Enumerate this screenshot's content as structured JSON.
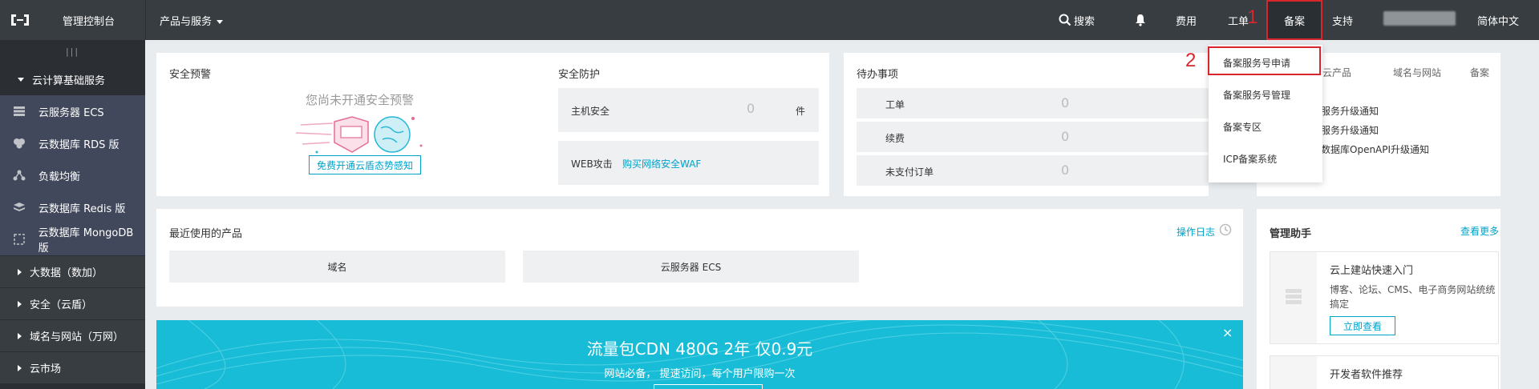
{
  "topbar": {
    "console_title": "管理控制台",
    "products_label": "产品与服务",
    "search_label": "搜索",
    "fee_label": "费用",
    "ticket_label": "工单",
    "beian_label": "备案",
    "support_label": "支持",
    "lang_label": "简体中文",
    "step1": "1",
    "step2": "2"
  },
  "sidebar": {
    "toggle": "|||",
    "cloud_group": "云计算基础服务",
    "items": [
      {
        "label": "云服务器 ECS",
        "icon": "server-icon"
      },
      {
        "label": "云数据库 RDS 版",
        "icon": "database-icon"
      },
      {
        "label": "负载均衡",
        "icon": "load-balancer-icon"
      },
      {
        "label": "云数据库 Redis 版",
        "icon": "redis-icon"
      },
      {
        "label": "云数据库 MongoDB 版",
        "icon": "mongodb-icon"
      }
    ],
    "groups": [
      "大数据（数加）",
      "安全（云盾）",
      "域名与网站（万网）",
      "云市场"
    ]
  },
  "security_alert": {
    "title": "安全预警",
    "empty_text": "您尚未开通安全预警",
    "button": "免费开通云盾态势感知"
  },
  "security_protect": {
    "title": "安全防护",
    "host_label": "主机安全",
    "host_value": "0",
    "host_unit": "件",
    "web_label": "WEB攻击",
    "web_link": "购买网络安全WAF"
  },
  "todo": {
    "title": "待办事项",
    "rows": [
      {
        "label": "工单",
        "value": "0"
      },
      {
        "label": "续费",
        "value": "0"
      },
      {
        "label": "未支付订单",
        "value": "0"
      }
    ]
  },
  "notice": {
    "tabs": [
      "云产品",
      "域名与网站",
      "备案"
    ],
    "lines": [
      "服务升级通知",
      "服务升级通知",
      "数据库OpenAPI升级通知"
    ]
  },
  "dropdown": {
    "items": [
      "备案服务号申请",
      "备案服务号管理",
      "备案专区",
      "ICP备案系统"
    ]
  },
  "recent": {
    "title": "最近使用的产品",
    "log_link": "操作日志",
    "products": [
      "域名",
      "云服务器 ECS"
    ]
  },
  "assistant": {
    "title": "管理助手",
    "more": "查看更多",
    "card1_title": "云上建站快速入门",
    "card1_desc": "博客、论坛、CMS、电子商务网站统统搞定",
    "card1_btn": "立即查看",
    "card2_title": "开发者软件推荐"
  },
  "banner": {
    "title": "流量包CDN 480G 2年 仅0.9元",
    "subtitle": "网站必备， 提速访问，每个用户限购一次",
    "close": "×"
  }
}
